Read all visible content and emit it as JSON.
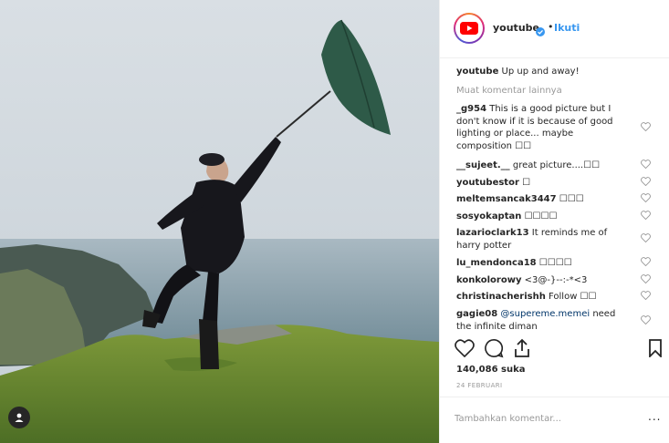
{
  "post": {
    "username": "youtube",
    "follow_label": "Ikuti",
    "caption_user": "youtube",
    "caption_text": "Up up and away!",
    "more_comments": "Muat komentar lainnya",
    "comments": [
      {
        "user": "_g954",
        "text": "This is a good picture but I don't know if it is because of good lighting or place... maybe composition ☐☐"
      },
      {
        "user": "__sujeet.__",
        "text": "great picture....☐☐"
      },
      {
        "user": "youtubestor",
        "text": "☐"
      },
      {
        "user": "meltemsancak3447",
        "text": "☐☐☐"
      },
      {
        "user": "sosyokaptan",
        "text": "☐☐☐☐"
      },
      {
        "user": "lazarioclark13",
        "text": "It reminds me of harry potter"
      },
      {
        "user": "lu_mendonca18",
        "text": "☐☐☐☐"
      },
      {
        "user": "konkolorowy",
        "text": "<3@-}--:-*<3"
      },
      {
        "user": "christinacherishh",
        "text": "Follow ☐☐"
      },
      {
        "user": "gagie08",
        "mention": "@supereme.memei",
        "text": "need the infinite diman"
      }
    ],
    "likes": "140,086 suka",
    "date": "24 FEBRUARI",
    "add_comment_placeholder": "Tambahkan komentar...",
    "options_label": "..."
  },
  "colors": {
    "link": "#3897f0",
    "accent": "#262626",
    "muted": "#999999",
    "verified": "#3897f0",
    "youtube_red": "#ff0000"
  },
  "icons": [
    "youtube-logo-icon",
    "verified-badge-icon",
    "heart-icon",
    "comment-icon",
    "share-icon",
    "bookmark-icon",
    "user-tag-icon",
    "heart-small-icon"
  ]
}
